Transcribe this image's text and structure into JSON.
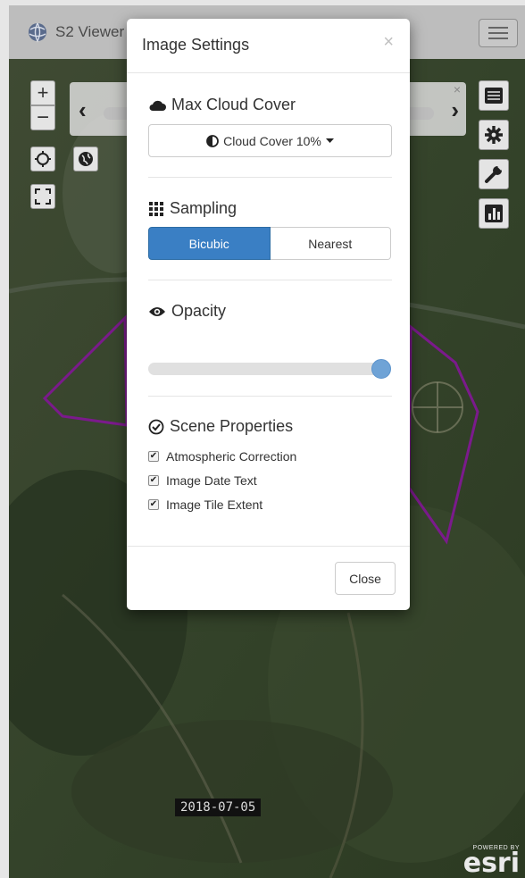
{
  "header": {
    "app_title": "S2 Viewer",
    "logo_icon": "globe-logo-icon",
    "menu_icon": "hamburger-icon"
  },
  "map": {
    "zoom_in_label": "+",
    "zoom_out_label": "−",
    "date_label": "2018-07-05",
    "attribution_small": "POWERED BY",
    "attribution_big": "esri",
    "icons": {
      "locate": "crosshair-icon",
      "basemap": "globe-icon",
      "fullscreen": "expand-icon",
      "layers": "list-icon",
      "settings": "gear-icon",
      "tools": "wrench-icon",
      "chart": "bar-chart-icon"
    },
    "timeline": {
      "prev_label": "‹",
      "next_label": "›",
      "close_label": "×"
    },
    "colors": {
      "aoi_outline": "#7b1a8c"
    }
  },
  "modal": {
    "title": "Image Settings",
    "close_x": "×",
    "cloud": {
      "heading": "Max Cloud Cover",
      "icon": "cloud-icon",
      "dropdown_label": "Cloud Cover 10%",
      "dropdown_icon": "half-circle-icon"
    },
    "sampling": {
      "heading": "Sampling",
      "icon": "grid-icon",
      "options": [
        "Bicubic",
        "Nearest"
      ],
      "selected": "Bicubic"
    },
    "opacity": {
      "heading": "Opacity",
      "icon": "eye-icon",
      "value_percent": 100
    },
    "scene": {
      "heading": "Scene Properties",
      "icon": "check-circle-icon",
      "options": [
        {
          "label": "Atmospheric Correction",
          "checked": true
        },
        {
          "label": "Image Date Text",
          "checked": true
        },
        {
          "label": "Image Tile Extent",
          "checked": true
        }
      ]
    },
    "close_button": "Close",
    "accent_color": "#3a7fc4"
  }
}
